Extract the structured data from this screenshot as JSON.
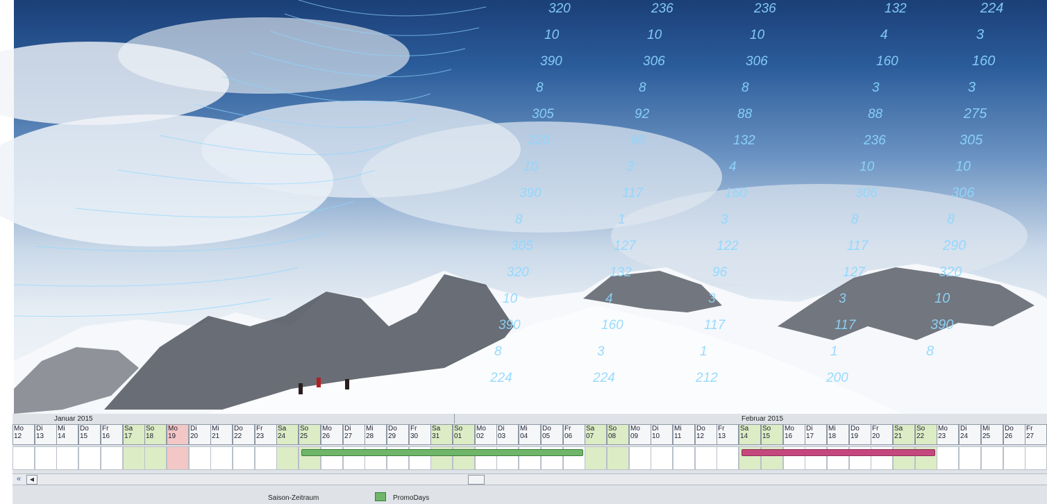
{
  "hero": {
    "numbers": [
      "320",
      "10",
      "390",
      "8",
      "305",
      "320",
      "10",
      "390",
      "8",
      "305",
      "320",
      "10",
      "390",
      "8",
      "224",
      "236",
      "10",
      "306",
      "8",
      "92",
      "96",
      "3",
      "117",
      "1",
      "127",
      "132",
      "4",
      "160",
      "3",
      "224",
      "236",
      "10",
      "306",
      "8",
      "88",
      "132",
      "4",
      "160",
      "3",
      "122",
      "96",
      "3",
      "117",
      "1",
      "212",
      "132",
      "4",
      "160",
      "3",
      "88",
      "236",
      "10",
      "306",
      "8",
      "117",
      "127",
      "3",
      "117",
      "1",
      "200",
      "224",
      "3",
      "160",
      "3",
      "275",
      "305",
      "10",
      "306",
      "8",
      "290",
      "320",
      "10",
      "390",
      "8"
    ]
  },
  "calendar": {
    "months": [
      "Januar 2015",
      "Februar 2015"
    ],
    "days": [
      {
        "d": "Mo",
        "n": "12",
        "t": "wd"
      },
      {
        "d": "Di",
        "n": "13",
        "t": "wd"
      },
      {
        "d": "Mi",
        "n": "14",
        "t": "wd"
      },
      {
        "d": "Do",
        "n": "15",
        "t": "wd"
      },
      {
        "d": "Fr",
        "n": "16",
        "t": "wd"
      },
      {
        "d": "Sa",
        "n": "17",
        "t": "we"
      },
      {
        "d": "So",
        "n": "18",
        "t": "we"
      },
      {
        "d": "Mo",
        "n": "19",
        "t": "hol"
      },
      {
        "d": "Di",
        "n": "20",
        "t": "wd"
      },
      {
        "d": "Mi",
        "n": "21",
        "t": "wd"
      },
      {
        "d": "Do",
        "n": "22",
        "t": "wd"
      },
      {
        "d": "Fr",
        "n": "23",
        "t": "wd"
      },
      {
        "d": "Sa",
        "n": "24",
        "t": "we"
      },
      {
        "d": "So",
        "n": "25",
        "t": "we"
      },
      {
        "d": "Mo",
        "n": "26",
        "t": "wd"
      },
      {
        "d": "Di",
        "n": "27",
        "t": "wd"
      },
      {
        "d": "Mi",
        "n": "28",
        "t": "wd"
      },
      {
        "d": "Do",
        "n": "29",
        "t": "wd"
      },
      {
        "d": "Fr",
        "n": "30",
        "t": "wd"
      },
      {
        "d": "Sa",
        "n": "31",
        "t": "we"
      },
      {
        "d": "So",
        "n": "01",
        "t": "we"
      },
      {
        "d": "Mo",
        "n": "02",
        "t": "wd"
      },
      {
        "d": "Di",
        "n": "03",
        "t": "wd"
      },
      {
        "d": "Mi",
        "n": "04",
        "t": "wd"
      },
      {
        "d": "Do",
        "n": "05",
        "t": "wd"
      },
      {
        "d": "Fr",
        "n": "06",
        "t": "wd"
      },
      {
        "d": "Sa",
        "n": "07",
        "t": "we"
      },
      {
        "d": "So",
        "n": "08",
        "t": "we"
      },
      {
        "d": "Mo",
        "n": "09",
        "t": "wd"
      },
      {
        "d": "Di",
        "n": "10",
        "t": "wd"
      },
      {
        "d": "Mi",
        "n": "11",
        "t": "wd"
      },
      {
        "d": "Do",
        "n": "12",
        "t": "wd"
      },
      {
        "d": "Fr",
        "n": "13",
        "t": "wd"
      },
      {
        "d": "Sa",
        "n": "14",
        "t": "we"
      },
      {
        "d": "So",
        "n": "15",
        "t": "we"
      },
      {
        "d": "Mo",
        "n": "16",
        "t": "wd"
      },
      {
        "d": "Di",
        "n": "17",
        "t": "wd"
      },
      {
        "d": "Mi",
        "n": "18",
        "t": "wd"
      },
      {
        "d": "Do",
        "n": "19",
        "t": "wd"
      },
      {
        "d": "Fr",
        "n": "20",
        "t": "wd"
      },
      {
        "d": "Sa",
        "n": "21",
        "t": "we"
      },
      {
        "d": "So",
        "n": "22",
        "t": "we"
      },
      {
        "d": "Mo",
        "n": "23",
        "t": "wd"
      },
      {
        "d": "Di",
        "n": "24",
        "t": "wd"
      },
      {
        "d": "Mi",
        "n": "25",
        "t": "wd"
      },
      {
        "d": "Do",
        "n": "26",
        "t": "wd"
      },
      {
        "d": "Fr",
        "n": "27",
        "t": "wd"
      }
    ],
    "bars": [
      {
        "name": "promo",
        "color": "#6fb56a",
        "from": "25",
        "to": "06"
      },
      {
        "name": "saison",
        "color": "#c4487d",
        "from": "14",
        "to": "22"
      }
    ],
    "legend": {
      "season_label": "Saison-Zeitraum",
      "promo_label": "PromoDays",
      "promo_color": "#6fb56a"
    }
  }
}
